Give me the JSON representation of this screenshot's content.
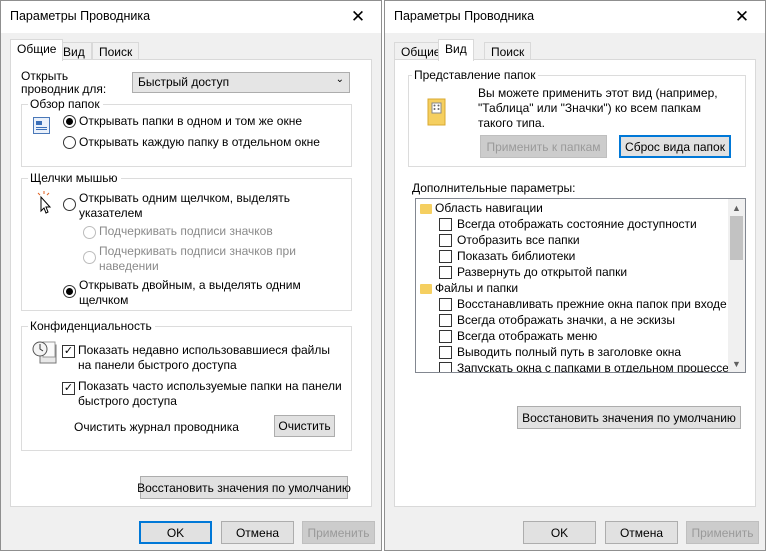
{
  "left": {
    "title": "Параметры Проводника",
    "tabs": [
      "Общие",
      "Вид",
      "Поиск"
    ],
    "open_explorer_label": "Открыть проводник для:",
    "open_explorer_value": "Быстрый доступ",
    "browse": {
      "label": "Обзор папок",
      "same_window": "Открывать папки в одном и том же окне",
      "new_window": "Открывать каждую папку в отдельном окне"
    },
    "clicks": {
      "label": "Щелчки мышью",
      "single_click": "Открывать одним щелчком, выделять указателем",
      "underline_always": "Подчеркивать подписи значков",
      "underline_hover": "Подчеркивать подписи значков при наведении",
      "double_click": "Открывать двойным, а выделять одним щелчком"
    },
    "privacy": {
      "label": "Конфиденциальность",
      "recent_files": "Показать недавно использовавшиеся файлы на панели быстрого доступа",
      "frequent_folders": "Показать часто используемые папки на панели быстрого доступа",
      "clear_history": "Очистить журнал проводника",
      "clear_button": "Очистить"
    },
    "restore_defaults": "Восстановить значения по умолчанию",
    "ok": "OK",
    "cancel": "Отмена",
    "apply": "Применить"
  },
  "right": {
    "title": "Параметры Проводника",
    "tabs": [
      "Общие",
      "Вид",
      "Поиск"
    ],
    "folder_views": {
      "label": "Представление папок",
      "description": "Вы можете применить этот вид (например, \"Таблица\" или \"Значки\") ко всем папкам такого типа.",
      "apply_button": "Применить к папкам",
      "reset_button": "Сброс вида папок"
    },
    "advanced_label": "Дополнительные параметры:",
    "tree": [
      {
        "type": "folder",
        "label": "Область навигации"
      },
      {
        "type": "check",
        "label": "Всегда отображать состояние доступности",
        "checked": false
      },
      {
        "type": "check",
        "label": "Отобразить все папки",
        "checked": false
      },
      {
        "type": "check",
        "label": "Показать библиотеки",
        "checked": false
      },
      {
        "type": "check",
        "label": "Развернуть до открытой папки",
        "checked": false
      },
      {
        "type": "folder",
        "label": "Файлы и папки"
      },
      {
        "type": "check",
        "label": "Восстанавливать прежние окна папок при входе в си",
        "checked": false
      },
      {
        "type": "check",
        "label": "Всегда отображать значки, а не эскизы",
        "checked": false
      },
      {
        "type": "check",
        "label": "Всегда отображать меню",
        "checked": false
      },
      {
        "type": "check",
        "label": "Выводить полный путь в заголовке окна",
        "checked": false
      },
      {
        "type": "check",
        "label": "Запускать окна с папками в отдельном процессе",
        "checked": false
      }
    ],
    "restore_defaults": "Восстановить значения по умолчанию",
    "ok": "OK",
    "cancel": "Отмена",
    "apply": "Применить"
  },
  "icons": {
    "close": "close-icon",
    "folder": "folder-icon",
    "scroll_up": "scroll-up-icon",
    "scroll_down": "scroll-down-icon"
  },
  "colors": {
    "accent": "#0078d7",
    "dialog_bg": "#f0f0f0",
    "panel_bg": "#ffffff",
    "folder": "#f5cf60"
  }
}
